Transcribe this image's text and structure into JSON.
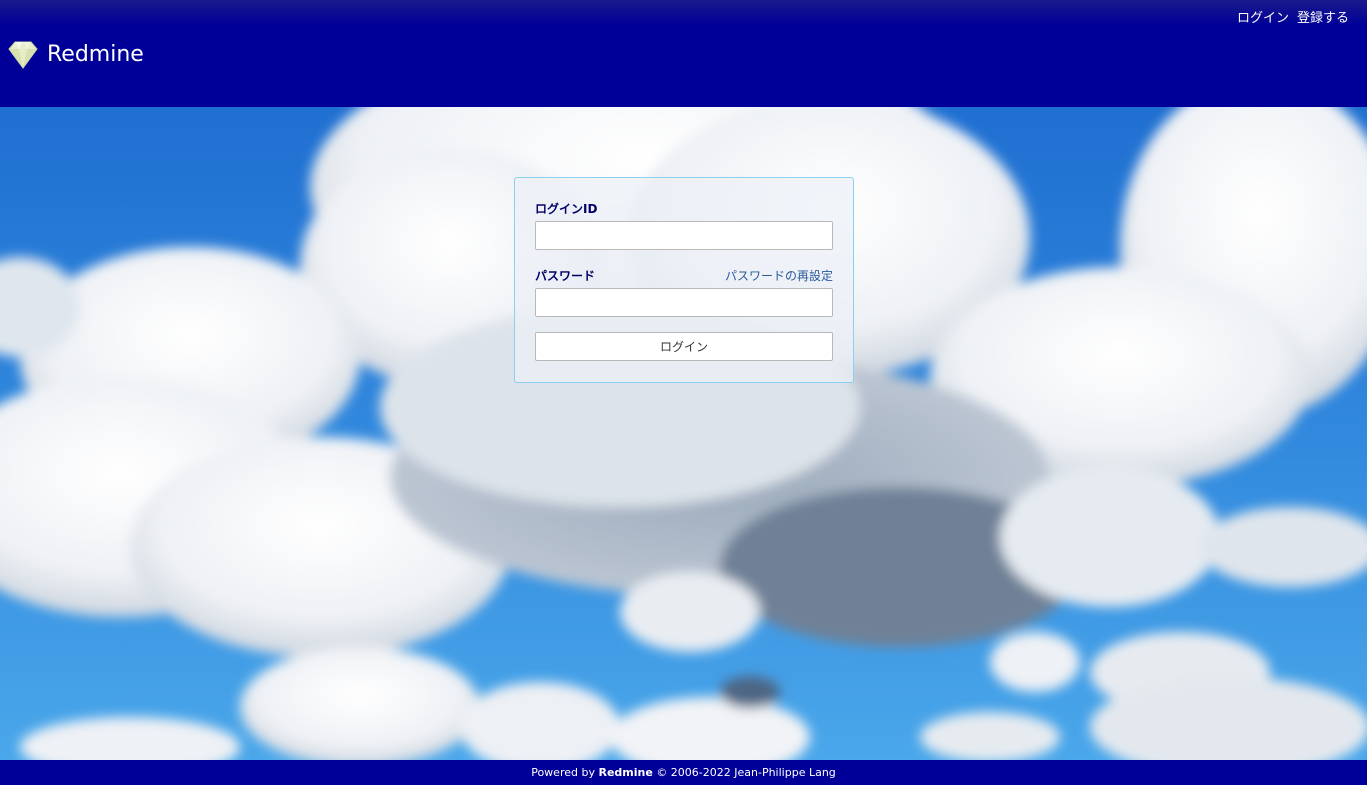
{
  "app": {
    "name": "Redmine"
  },
  "top_menu": {
    "login": "ログイン",
    "register": "登録する"
  },
  "login_form": {
    "username_label": "ログインID",
    "password_label": "パスワード",
    "lost_password_link": "パスワードの再設定",
    "username_value": "",
    "password_value": "",
    "submit_label": "ログイン"
  },
  "footer": {
    "prefix": "Powered by",
    "product": "Redmine",
    "suffix": "© 2006-2022 Jean-Philippe Lang"
  },
  "colors": {
    "header_bg": "#000099",
    "footer_bg": "#000099",
    "label_text": "#000066",
    "link_text": "#2a5a9a",
    "box_border": "#8ccfee"
  }
}
